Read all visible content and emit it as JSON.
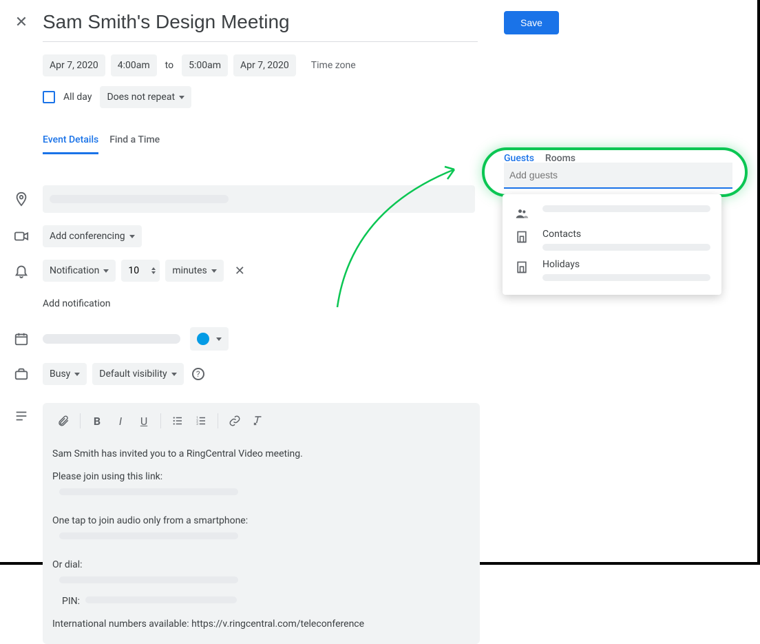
{
  "header": {
    "title": "Sam Smith's Design Meeting",
    "save_label": "Save"
  },
  "datetime": {
    "start_date": "Apr 7, 2020",
    "start_time": "4:00am",
    "to_label": "to",
    "end_time": "5:00am",
    "end_date": "Apr 7, 2020",
    "timezone_label": "Time zone"
  },
  "options": {
    "all_day_label": "All day",
    "repeat_label": "Does not repeat"
  },
  "tabs": {
    "details": "Event Details",
    "find_time": "Find a Time"
  },
  "conferencing": {
    "add_label": "Add conferencing"
  },
  "notification": {
    "type_label": "Notification",
    "value": "10",
    "unit_label": "minutes",
    "add_label": "Add notification"
  },
  "availability": {
    "busy_label": "Busy",
    "visibility_label": "Default visibility"
  },
  "description": {
    "line1": "Sam Smith has invited you to a RingCentral Video meeting.",
    "line2": "Please join using this link:",
    "line3": "One tap to join audio only from a smartphone:",
    "line4": "Or dial:",
    "line5": "PIN:",
    "line6": "International numbers available: https://v.ringcentral.com/teleconference"
  },
  "guest_panel": {
    "tab_guests": "Guests",
    "tab_rooms": "Rooms",
    "placeholder": "Add guests",
    "suggestions": {
      "contacts": "Contacts",
      "holidays": "Holidays"
    }
  }
}
